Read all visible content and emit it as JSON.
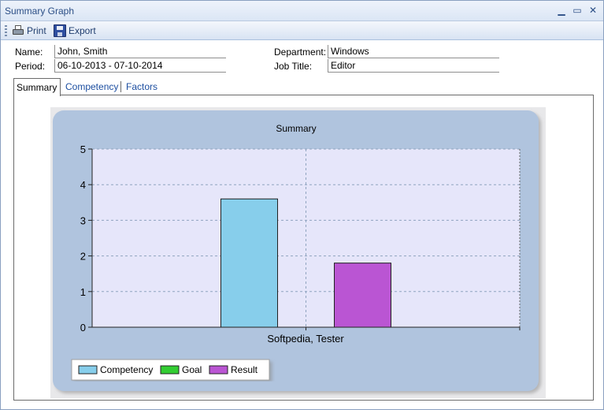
{
  "window": {
    "title": "Summary Graph",
    "minimize_symbol": "▁",
    "maximize_symbol": "▭",
    "close_symbol": "✕"
  },
  "toolbar": {
    "print_label": "Print",
    "export_label": "Export",
    "print_icon": "printer-icon",
    "export_icon": "floppy-disk-icon"
  },
  "form": {
    "name_label": "Name:",
    "name_value": "John, Smith",
    "period_label": "Period:",
    "period_value": "06-10-2013 - 07-10-2014",
    "department_label": "Department:",
    "department_value": "Windows",
    "job_title_label": "Job Title:",
    "job_title_value": "Editor"
  },
  "tabs": [
    {
      "label": "Summary",
      "active": true
    },
    {
      "label": "Competency",
      "active": false
    },
    {
      "label": "Factors",
      "active": false
    }
  ],
  "chart_data": {
    "type": "bar",
    "title": "Summary",
    "categories": [
      "Softpedia, Tester"
    ],
    "series": [
      {
        "name": "Competency",
        "values": [
          3.6
        ],
        "color": "#87ceeb"
      },
      {
        "name": "Goal",
        "values": [
          0
        ],
        "color": "#32cd32"
      },
      {
        "name": "Result",
        "values": [
          1.8
        ],
        "color": "#ba55d3"
      }
    ],
    "ylim": [
      0,
      5
    ],
    "yticks": [
      "0",
      "1",
      "2",
      "3",
      "4",
      "5"
    ],
    "grid": true,
    "legend_position": "bottom-left",
    "plot_background": "#e6e6fa",
    "panel_background": "#b0c4de"
  }
}
